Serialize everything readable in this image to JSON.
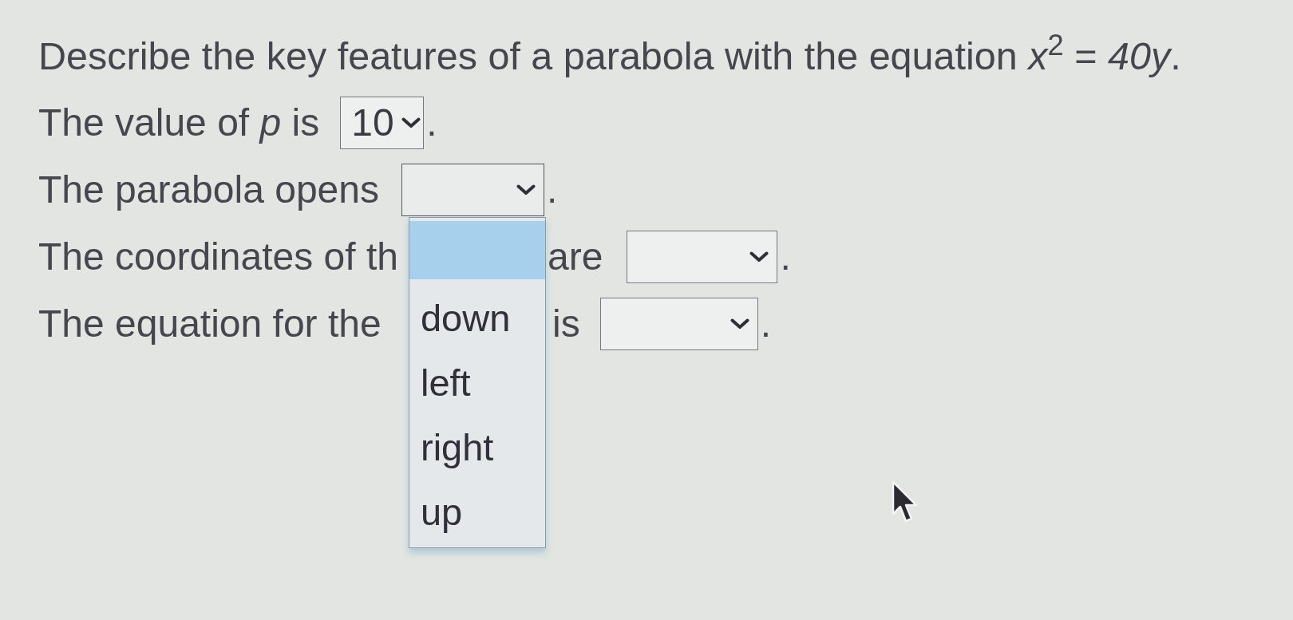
{
  "prompt": "Describe the key features of a parabola with the equation *x*$^{2}$ = *40y*.",
  "lines": [
    {
      "before": "The value of *p* is",
      "dropdown": {
        "value": "10",
        "expanded": false
      },
      "after": "."
    },
    {
      "before": "The parabola opens",
      "dropdown": {
        "expanded": true,
        "options": [
          {
            "kind": "blank",
            "highlighted": true
          },
          {
            "kind": "text",
            "label": "down",
            "highlighted": false
          },
          {
            "kind": "text",
            "label": "left",
            "highlighted": false
          },
          {
            "kind": "text",
            "label": "right",
            "highlighted": false
          },
          {
            "kind": "text",
            "label": "up",
            "highlighted": false
          }
        ]
      },
      "after": "."
    },
    {
      "before": "The coordinates of th",
      "middle": "are",
      "dropdown": {
        "expanded": false
      },
      "after": "."
    },
    {
      "before": "The equation for the",
      "middle": "is",
      "dropdown": {
        "expanded": false
      },
      "after": "."
    }
  ]
}
